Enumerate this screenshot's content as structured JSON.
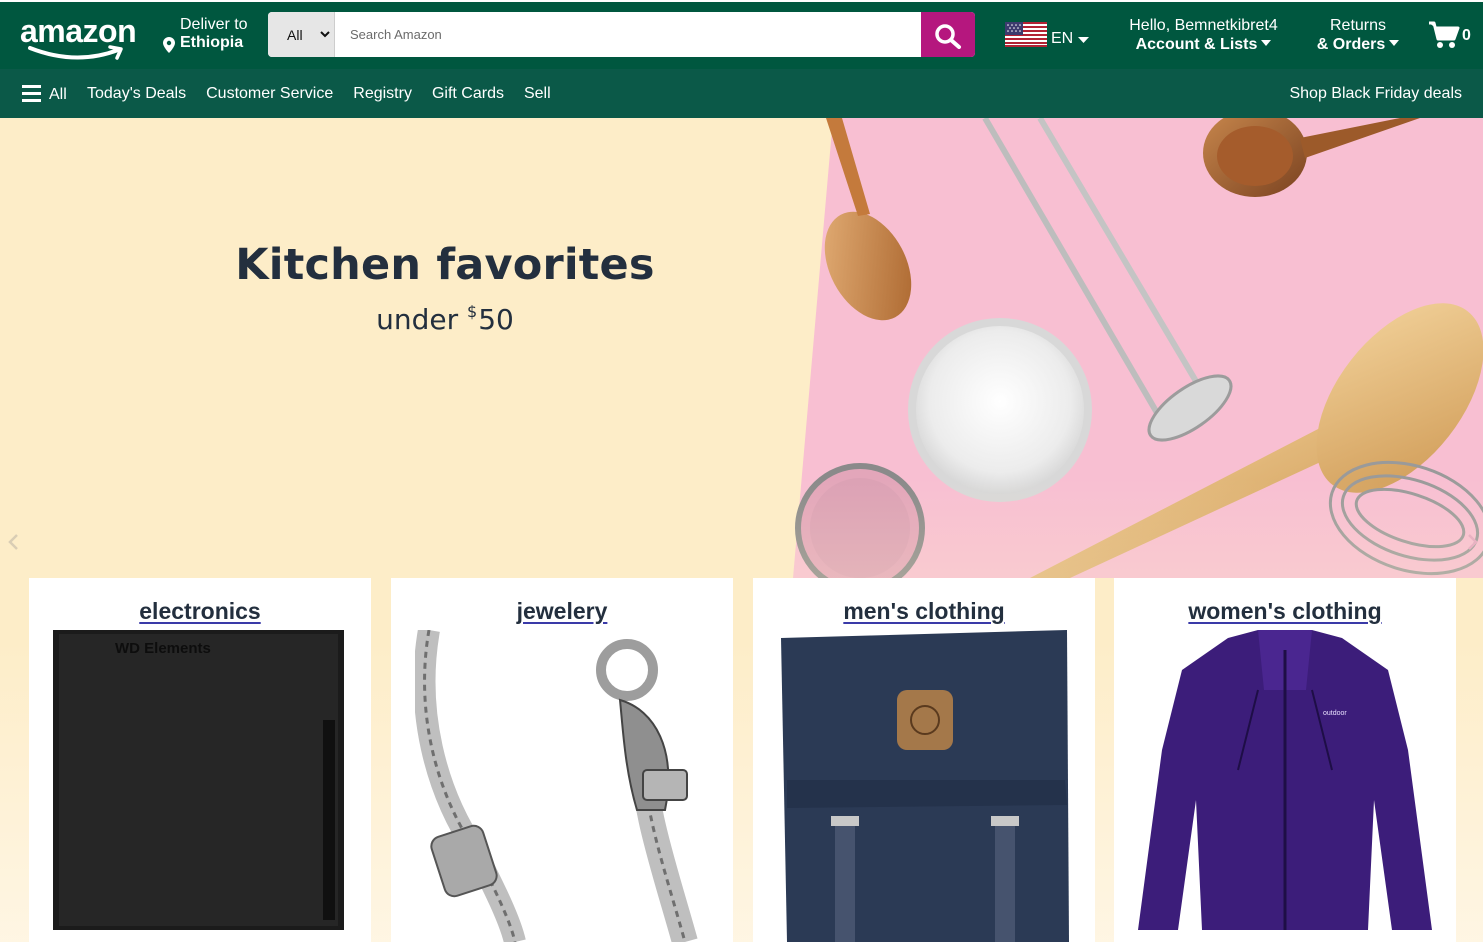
{
  "header": {
    "logo_text": "amazon",
    "deliver_line1": "Deliver to",
    "deliver_line2": "Ethiopia",
    "search": {
      "category": "All",
      "placeholder": "Search Amazon",
      "value": ""
    },
    "language": "EN",
    "account_line1": "Hello, Bemnetkibret4",
    "account_line2": "Account & Lists",
    "orders_line1": "Returns",
    "orders_line2": "& Orders",
    "cart_count": "0"
  },
  "navbar": {
    "all_label": "All",
    "links": [
      "Today's Deals",
      "Customer Service",
      "Registry",
      "Gift Cards",
      "Sell"
    ],
    "promo": "Shop Black Friday deals"
  },
  "hero": {
    "title": "Kitchen favorites",
    "subtitle_prefix": "under ",
    "currency": "$",
    "amount": "50"
  },
  "categories": [
    {
      "title": "electronics",
      "product_text": "WD Elements"
    },
    {
      "title": "jewelery"
    },
    {
      "title": "men's clothing"
    },
    {
      "title": "women's clothing",
      "product_text": "outdoor"
    }
  ],
  "colors": {
    "header_bg": "#00573f",
    "nav_bg": "#0b5948",
    "search_button": "#b5177e",
    "hero_left": "#fdedc8",
    "hero_right": "#f8bfd2"
  },
  "icons": {
    "search": "search-icon",
    "cart": "cart-icon",
    "location": "location-pin-icon",
    "menu": "hamburger-icon",
    "flag": "us-flag-icon"
  }
}
